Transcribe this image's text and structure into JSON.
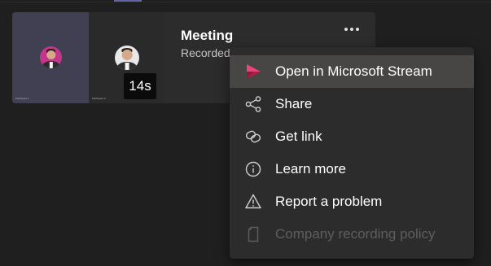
{
  "recording_card": {
    "title": "Meeting",
    "subtitle": "Recorded by",
    "duration": "14s",
    "participants": [
      {
        "name": "Participant 1"
      },
      {
        "name": "Participant 2"
      }
    ],
    "more_icon": "more-horizontal-icon"
  },
  "context_menu": {
    "items": [
      {
        "label": "Open in Microsoft Stream",
        "icon": "stream-icon",
        "active": true,
        "disabled": false
      },
      {
        "label": "Share",
        "icon": "share-icon",
        "active": false,
        "disabled": false
      },
      {
        "label": "Get link",
        "icon": "link-icon",
        "active": false,
        "disabled": false
      },
      {
        "label": "Learn more",
        "icon": "info-icon",
        "active": false,
        "disabled": false
      },
      {
        "label": "Report a problem",
        "icon": "warning-icon",
        "active": false,
        "disabled": false
      },
      {
        "label": "Company recording policy",
        "icon": "document-icon",
        "active": false,
        "disabled": true
      }
    ]
  },
  "colors": {
    "background": "#1f1f1f",
    "card": "#2d2c2c",
    "menu_hover": "#484644",
    "stream_brand": "#bc1948",
    "text": "#ffffff",
    "disabled_text": "#5e5e5e",
    "accent": "#6264a7"
  }
}
